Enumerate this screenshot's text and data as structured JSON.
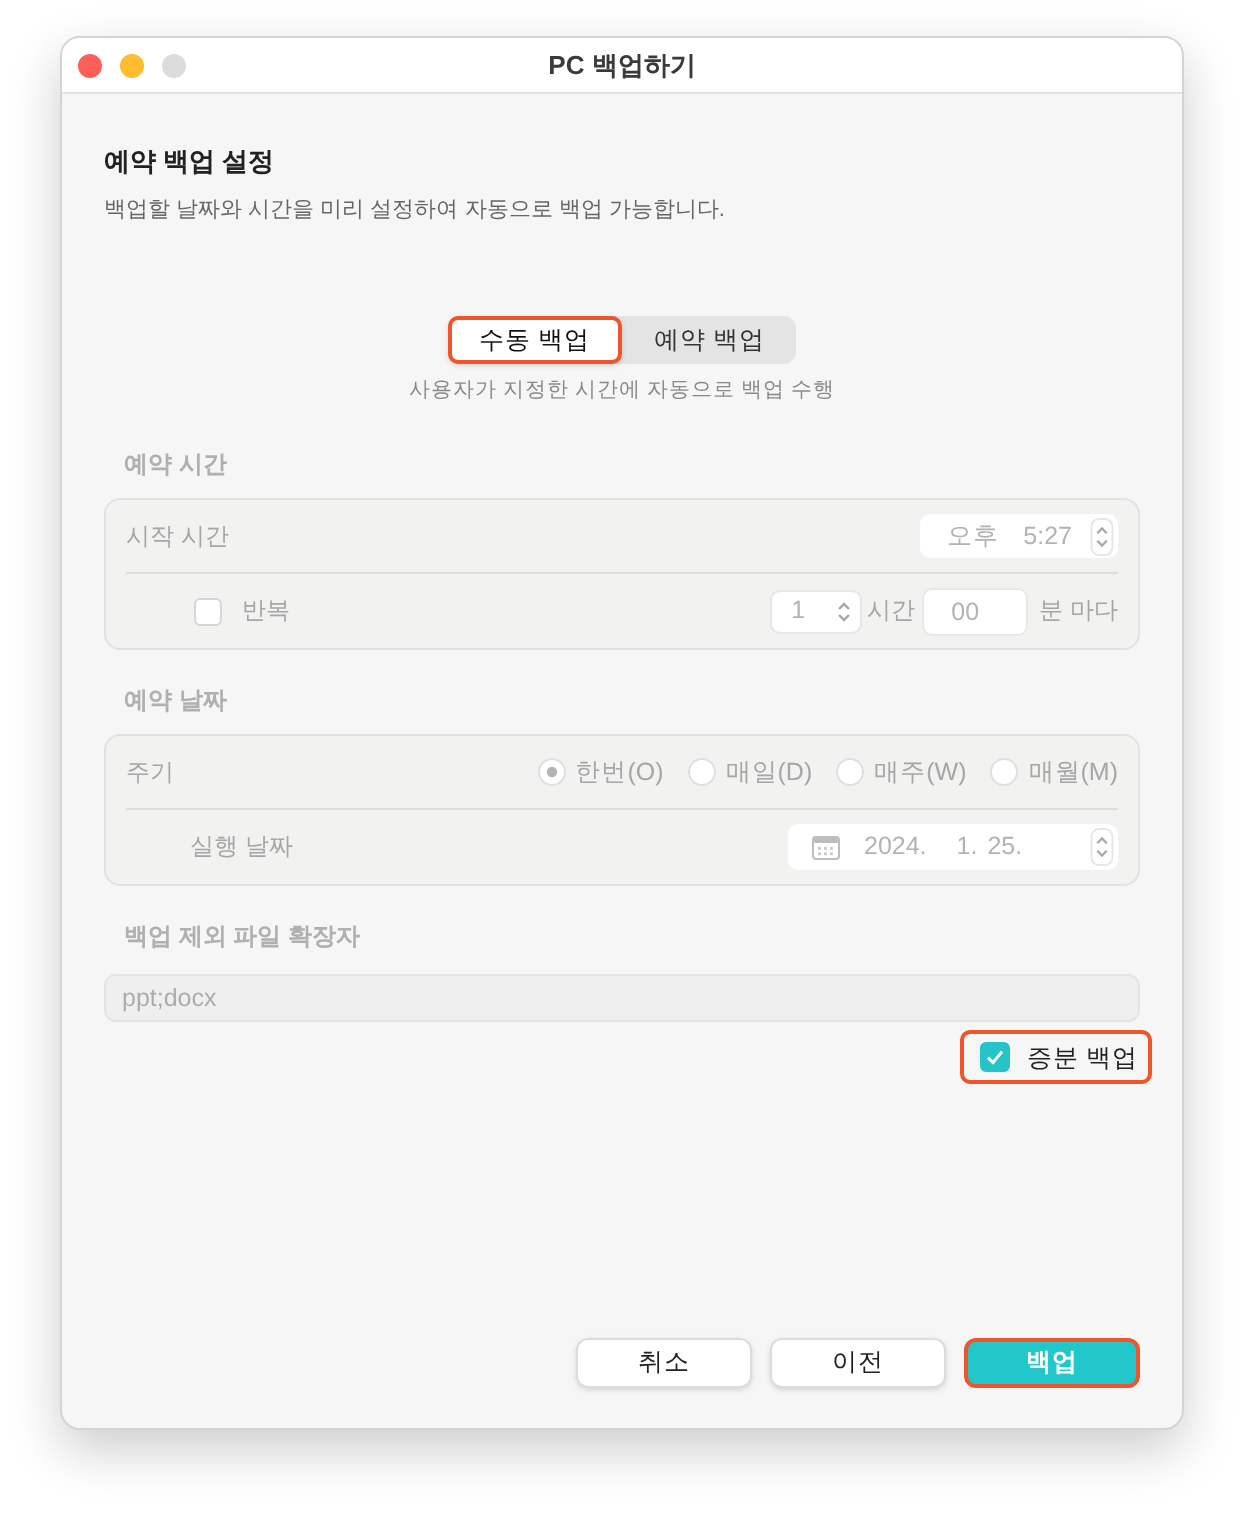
{
  "window": {
    "title": "PC 백업하기",
    "controls": [
      {
        "kind": "close",
        "disabled": false
      },
      {
        "kind": "minimize",
        "disabled": false
      },
      {
        "kind": "zoom",
        "disabled": true
      }
    ]
  },
  "header": {
    "title": "예약 백업 설정",
    "description": "백업할 날짜와 시간을 미리 설정하여 자동으로 백업 가능합니다."
  },
  "mode_tabs": [
    {
      "label": "수동 백업",
      "selected": true,
      "highlighted": true
    },
    {
      "label": "예약 백업",
      "selected": false,
      "highlighted": false
    }
  ],
  "mode_caption": "사용자가 지정한 시간에 자동으로 백업 수행",
  "schedule_time": {
    "title": "예약 시간",
    "disabled": true,
    "start_label": "시작 시간",
    "start_period": "오후",
    "start_time": "5:27",
    "repeat": {
      "label": "반복",
      "checked": false,
      "count": "1",
      "hours_label": "시간",
      "minutes_value": "00",
      "minutes_label": "분 마다"
    }
  },
  "schedule_date": {
    "title": "예약 날짜",
    "disabled": true,
    "cycle_label": "주기",
    "cycle_options": [
      {
        "label": "한번(O)",
        "selected": true
      },
      {
        "label": "매일(D)",
        "selected": false
      },
      {
        "label": "매주(W)",
        "selected": false
      },
      {
        "label": "매월(M)",
        "selected": false
      }
    ],
    "date_label": "실행 날짜",
    "date_parts": [
      "2024.",
      "1.",
      "25."
    ]
  },
  "exclusion": {
    "title": "백업 제외 파일 확장자",
    "value": "ppt;docx",
    "disabled": true
  },
  "incremental_backup": {
    "label": "증분 백업",
    "checked": true,
    "highlighted": true
  },
  "buttons": [
    {
      "label": "취소",
      "kind": "default",
      "highlighted": false
    },
    {
      "label": "이전",
      "kind": "default",
      "highlighted": false
    },
    {
      "label": "백업",
      "kind": "primary",
      "highlighted": true
    }
  ]
}
